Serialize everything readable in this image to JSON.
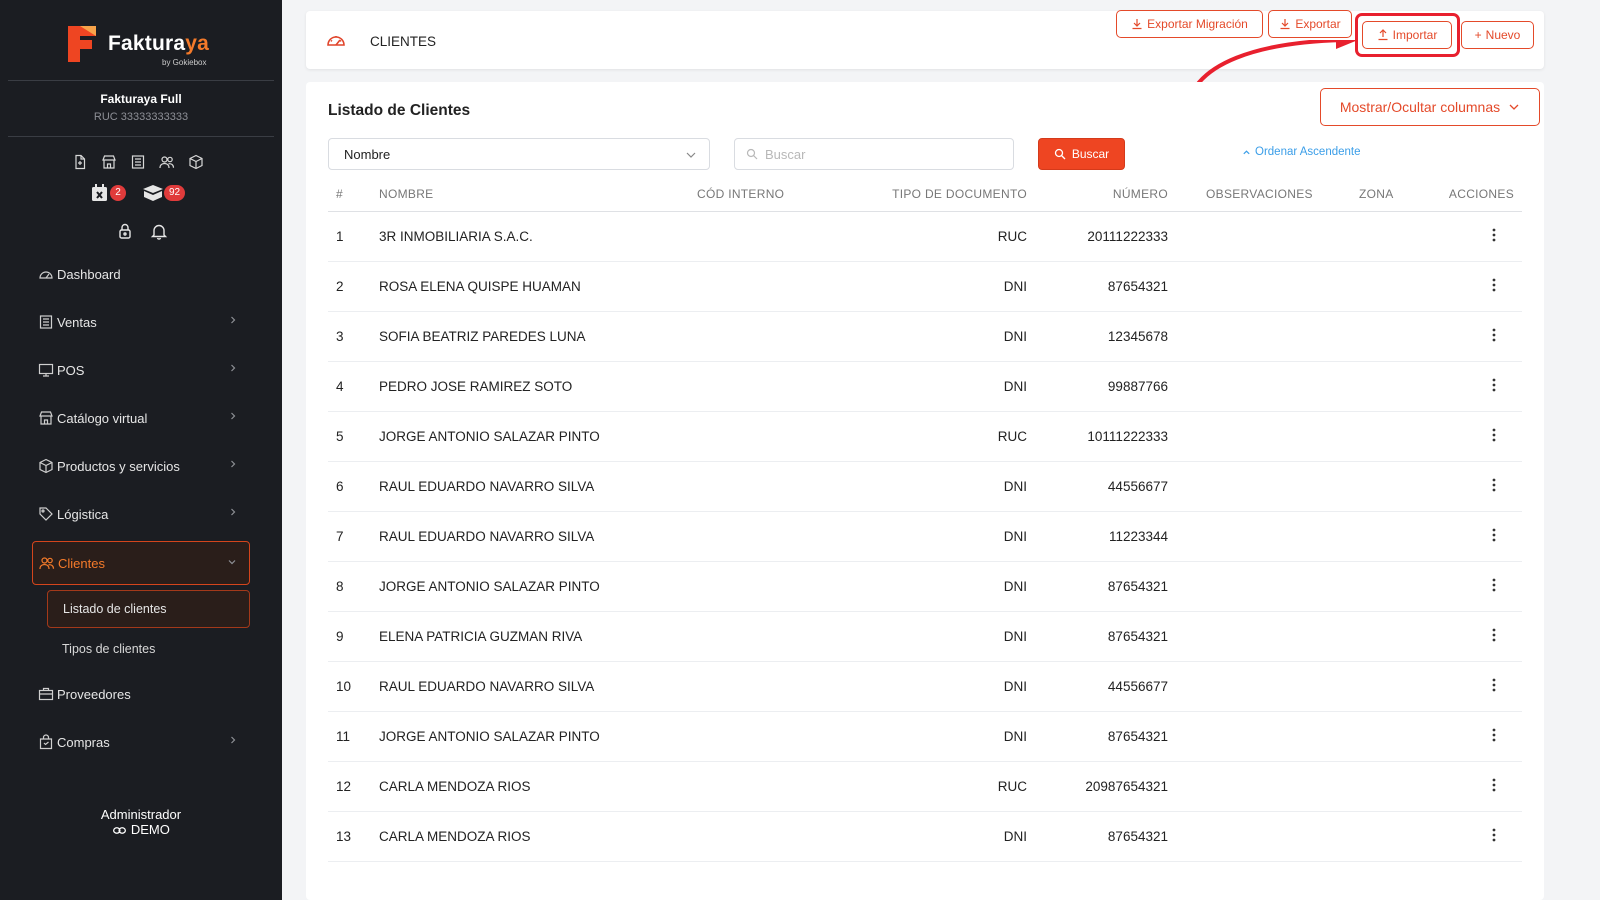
{
  "brand": {
    "name_a": "Faktura",
    "name_b": "ya",
    "tagline": "by Gokiebox"
  },
  "company": {
    "name": "Fakturaya Full",
    "ruc": "RUC 33333333333"
  },
  "quick_icons": [
    "file-icon",
    "store-icon",
    "receipt-icon",
    "users-icon",
    "box-icon"
  ],
  "badges": {
    "calendar": "2",
    "inventory": "92"
  },
  "sidebar": {
    "items": [
      {
        "label": "Dashboard",
        "icon": "gauge-icon",
        "has_chevron": false
      },
      {
        "label": "Ventas",
        "icon": "receipt-icon",
        "has_chevron": true
      },
      {
        "label": "POS",
        "icon": "monitor-icon",
        "has_chevron": true
      },
      {
        "label": "Catálogo virtual",
        "icon": "store-icon",
        "has_chevron": true
      },
      {
        "label": "Productos y servicios",
        "icon": "box-icon",
        "has_chevron": true
      },
      {
        "label": "Lógistica",
        "icon": "tag-icon",
        "has_chevron": true
      },
      {
        "label": "Clientes",
        "icon": "users-icon",
        "has_chevron": true,
        "expanded": true
      },
      {
        "label": "Proveedores",
        "icon": "briefcase-icon",
        "has_chevron": false
      },
      {
        "label": "Compras",
        "icon": "bag-icon",
        "has_chevron": true
      }
    ],
    "sub_items": [
      {
        "label": "Listado de clientes",
        "active": true
      },
      {
        "label": "Tipos de clientes",
        "active": false
      }
    ]
  },
  "user": {
    "name": "Administrador",
    "role": "DEMO"
  },
  "header": {
    "title": "CLIENTES",
    "buttons": {
      "export_migration": "Exportar Migración",
      "export": "Exportar",
      "import": "Importar",
      "new": "Nuevo"
    }
  },
  "list": {
    "title": "Listado de Clientes",
    "columns_button": "Mostrar/Ocultar columnas",
    "filter_field": "Nombre",
    "search_placeholder": "Buscar",
    "search_button": "Buscar",
    "sort_link": "Ordenar Ascendente",
    "columns": [
      "#",
      "NOMBRE",
      "CÓD INTERNO",
      "TIPO DE DOCUMENTO",
      "NÚMERO",
      "OBSERVACIONES",
      "ZONA",
      "ACCIONES"
    ],
    "rows": [
      {
        "n": "1",
        "name": "3R INMOBILIARIA S.A.C.",
        "doc_type": "RUC",
        "number": "20111222333"
      },
      {
        "n": "2",
        "name": "ROSA ELENA QUISPE HUAMAN",
        "doc_type": "DNI",
        "number": "87654321"
      },
      {
        "n": "3",
        "name": "SOFIA BEATRIZ PAREDES LUNA",
        "doc_type": "DNI",
        "number": "12345678"
      },
      {
        "n": "4",
        "name": "PEDRO JOSE RAMIREZ SOTO",
        "doc_type": "DNI",
        "number": "99887766"
      },
      {
        "n": "5",
        "name": "JORGE ANTONIO SALAZAR PINTO",
        "doc_type": "RUC",
        "number": "10111222333"
      },
      {
        "n": "6",
        "name": "RAUL EDUARDO NAVARRO SILVA",
        "doc_type": "DNI",
        "number": "44556677"
      },
      {
        "n": "7",
        "name": "RAUL EDUARDO NAVARRO SILVA",
        "doc_type": "DNI",
        "number": "11223344"
      },
      {
        "n": "8",
        "name": "JORGE ANTONIO SALAZAR PINTO",
        "doc_type": "DNI",
        "number": "87654321"
      },
      {
        "n": "9",
        "name": "ELENA PATRICIA GUZMAN RIVA",
        "doc_type": "DNI",
        "number": "87654321"
      },
      {
        "n": "10",
        "name": "RAUL EDUARDO NAVARRO SILVA",
        "doc_type": "DNI",
        "number": "44556677"
      },
      {
        "n": "11",
        "name": "JORGE ANTONIO SALAZAR PINTO",
        "doc_type": "DNI",
        "number": "87654321"
      },
      {
        "n": "12",
        "name": "CARLA MENDOZA RIOS",
        "doc_type": "RUC",
        "number": "20987654321"
      },
      {
        "n": "13",
        "name": "CARLA MENDOZA RIOS",
        "doc_type": "DNI",
        "number": "87654321"
      }
    ]
  },
  "colors": {
    "accent": "#ee4522",
    "sidebar_bg": "#1b1d22",
    "highlight": "#e8202e",
    "link": "#3b9ee8"
  }
}
